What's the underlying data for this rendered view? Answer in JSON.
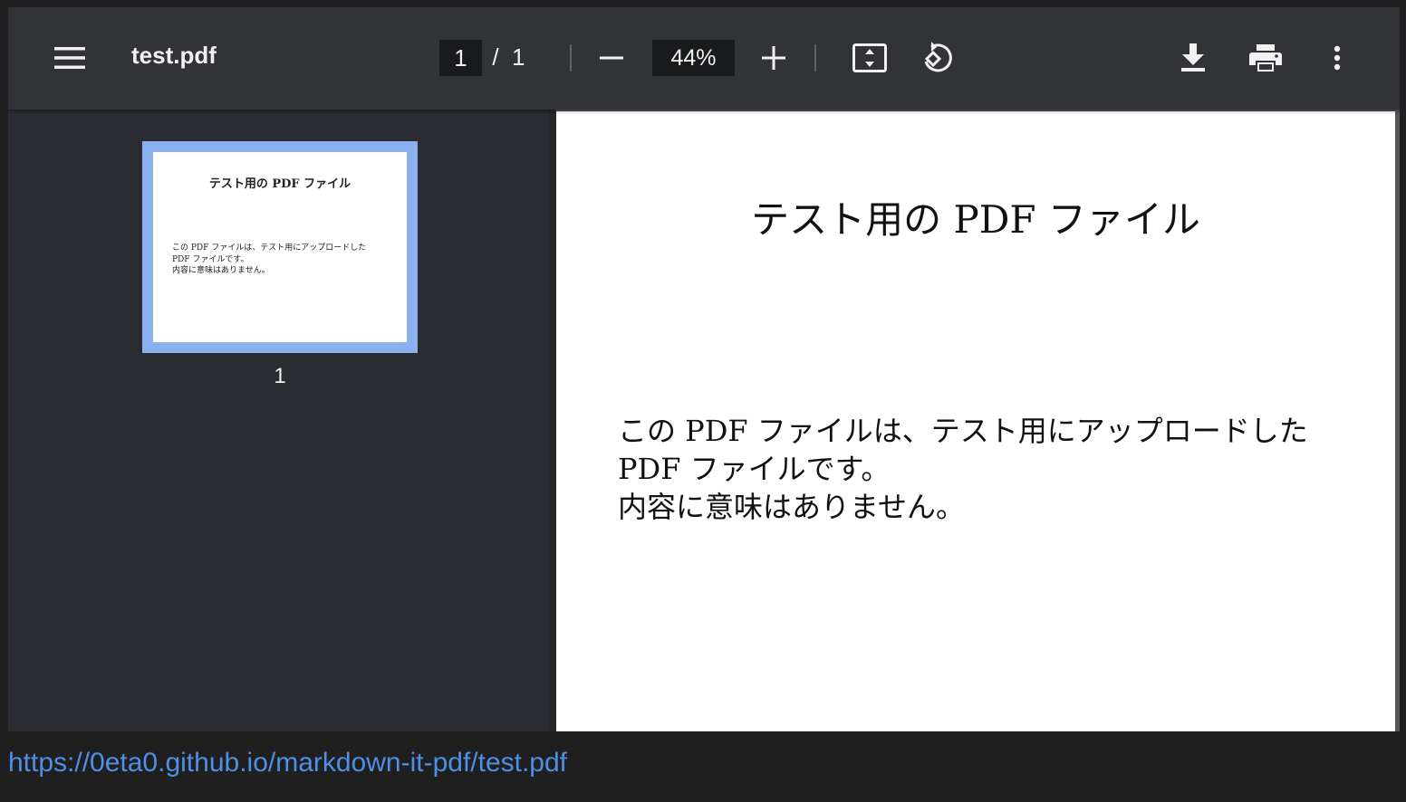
{
  "toolbar": {
    "title": "test.pdf",
    "page_current": "1",
    "page_separator": "/",
    "page_total": "1",
    "zoom_value": "44%",
    "icons": {
      "menu": "menu-icon",
      "zoom_out": "minus-icon",
      "zoom_in": "plus-icon",
      "fit": "fit-to-page-icon",
      "rotate": "rotate-counterclockwise-icon",
      "download": "download-icon",
      "print": "print-icon",
      "more": "more-vertical-icon"
    }
  },
  "sidebar": {
    "thumbnails": [
      {
        "page_number": "1",
        "title": "テスト用の PDF ファイル",
        "body_lines": [
          "この PDF ファイルは、テスト用にアップロードした",
          "PDF ファイルです。",
          "内容に意味はありません。"
        ]
      }
    ]
  },
  "document": {
    "title": "テスト用の PDF ファイル",
    "body_lines": [
      "この PDF ファイルは、テスト用にアップロードした",
      "PDF ファイルです。",
      "内容に意味はありません。"
    ]
  },
  "status_bar": {
    "url": "https://0eta0.github.io/markdown-it-pdf/test.pdf"
  },
  "colors": {
    "toolbar_bg": "#323337",
    "sidebar_bg": "#2b2c31",
    "thumbnail_selected_border": "#8ab0f0",
    "link": "#4f8fe6"
  }
}
